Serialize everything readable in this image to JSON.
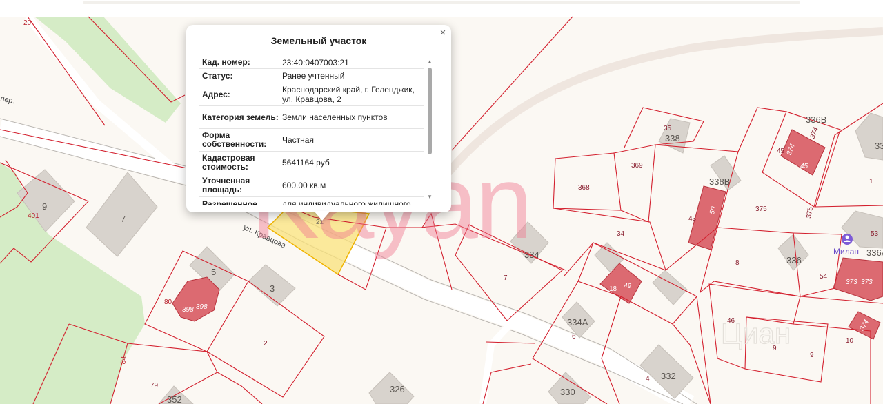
{
  "popup": {
    "title": "Земельный участок",
    "close": "×",
    "rows": [
      {
        "key": "Кад. номер:",
        "value": "23:40:0407003:21"
      },
      {
        "key": "Статус:",
        "value": "Ранее учтенный"
      },
      {
        "key": "Адрес:",
        "value": "Краснодарский край, г. Геленджик, ул. Кравцова, 2"
      },
      {
        "key": "Категория земель:",
        "value": "Земли населенных пунктов"
      },
      {
        "key": "Форма собственности:",
        "value": "Частная"
      },
      {
        "key": "Кадастровая стоимость:",
        "value": "5641164 руб"
      },
      {
        "key": "Уточненная площадь:",
        "value": "600.00 кв.м"
      },
      {
        "key": "Разрешенное",
        "value": "для индивидуального жилищного"
      }
    ],
    "scroll_up": "▲",
    "scroll_down": "▼"
  },
  "map": {
    "street_label": "ул. Кравцова",
    "lane_label": "пер.",
    "poi": {
      "name": "Милан",
      "icon": "person-pin-icon"
    },
    "parcel_numbers": [
      "20",
      "9",
      "401",
      "7",
      "21",
      "5",
      "3",
      "80",
      "398",
      "398",
      "2",
      "84",
      "79",
      "352",
      "326",
      "7",
      "34",
      "49",
      "18",
      "334А",
      "6",
      "4",
      "332",
      "330",
      "368",
      "369",
      "35",
      "338",
      "338В",
      "43",
      "50",
      "375",
      "375",
      "336В",
      "45",
      "374",
      "374",
      "45",
      "8",
      "336",
      "54",
      "373",
      "373",
      "53",
      "336А",
      "1",
      "33",
      "46",
      "9",
      "9",
      "10",
      "374"
    ],
    "house_numbers": [
      "9",
      "7",
      "5",
      "3",
      "2",
      "334",
      "334А",
      "332",
      "330",
      "338",
      "338В",
      "336В",
      "336",
      "336А",
      "326",
      "352",
      "33"
    ],
    "watermark_main": "Kayan",
    "watermark_secondary": "Циан",
    "colors": {
      "background": "#fbf8f3",
      "green": "#d5ecc6",
      "parcel_line": "#d3202e",
      "selected_parcel": "#f9e179",
      "building": "#d8d3cd",
      "registered_building": "#dc6a71",
      "road": "#ffffff",
      "watermark": "#f07891"
    }
  }
}
